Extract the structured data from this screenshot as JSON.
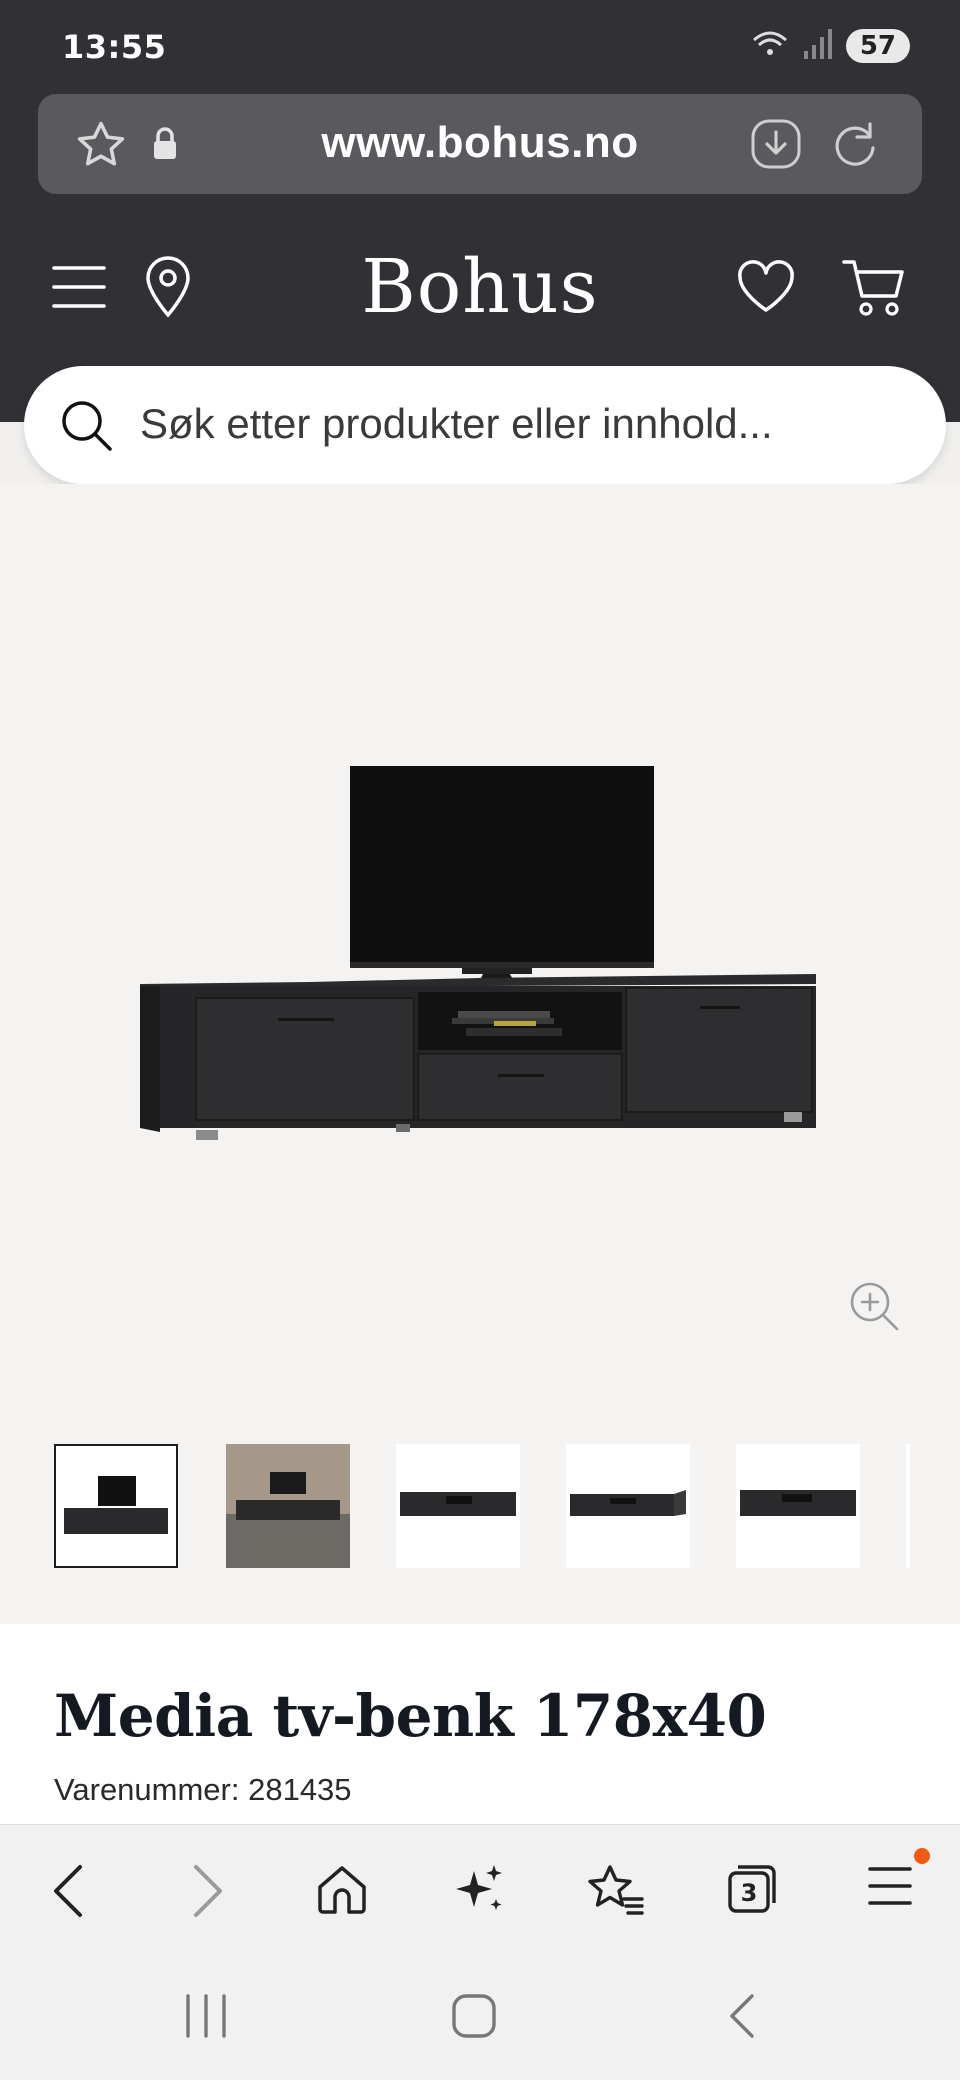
{
  "status": {
    "time": "13:55",
    "battery": "57"
  },
  "browser": {
    "url": "www.bohus.no"
  },
  "site": {
    "brand": "Bohus",
    "search_placeholder": "Søk etter produkter eller innhold..."
  },
  "product": {
    "title": "Media tv-benk 178x40",
    "sku_label": "Varenummer: 281435",
    "thumbnails": [
      "thumb-1",
      "thumb-2",
      "thumb-3",
      "thumb-4",
      "thumb-5"
    ]
  },
  "icons": {
    "favorite": "star-icon",
    "lock": "lock-icon",
    "download": "download-icon",
    "reload": "reload-icon",
    "menu": "menu-icon",
    "location": "location-pin-icon",
    "wishlist": "heart-icon",
    "cart": "cart-icon",
    "search": "search-icon",
    "zoom": "zoom-in-icon"
  },
  "colors": {
    "chrome_dark": "#313135",
    "title": "#151a22",
    "notify_dot": "#f25a14"
  }
}
